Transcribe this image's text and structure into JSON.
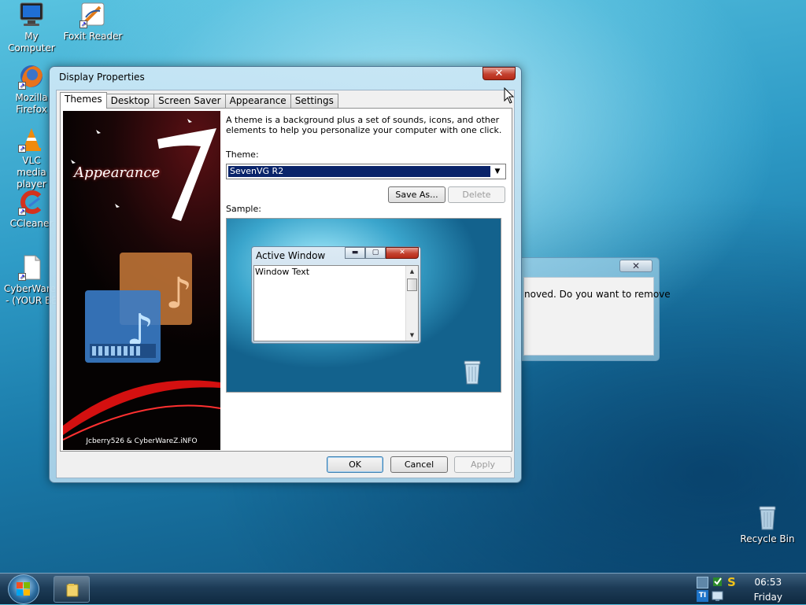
{
  "desktop": {
    "icons": [
      {
        "label": "My Computer",
        "icon": "monitor-icon"
      },
      {
        "label": "Foxit Reader",
        "icon": "foxit-icon"
      },
      {
        "label": "Mozilla Firefox",
        "icon": "firefox-icon"
      },
      {
        "label": "VLC media player",
        "icon": "vlc-cone-icon"
      },
      {
        "label": "CCleaner",
        "icon": "ccleaner-icon"
      },
      {
        "label": "CyberWareZ - (YOUR BE",
        "icon": "document-icon"
      },
      {
        "label": "Recycle Bin",
        "icon": "recycle-bin-icon"
      }
    ]
  },
  "background_dialog": {
    "close_label": "✕",
    "message": "noved.  Do you want to remove"
  },
  "dialog": {
    "title": "Display Properties",
    "close_label": "✕",
    "tabs": [
      "Themes",
      "Desktop",
      "Screen Saver",
      "Appearance",
      "Settings"
    ],
    "active_tab": "Themes",
    "art": {
      "title": "Appearance",
      "numeral": "7",
      "credit": "Jcberry526 & CyberWareZ.iNFO"
    },
    "description": "A theme is a background plus a set of sounds, icons, and other elements to help you personalize your computer with one click.",
    "theme_label": "Theme:",
    "theme_value": "SevenVG R2",
    "save_as_label": "Save As...",
    "delete_label": "Delete",
    "sample_label": "Sample:",
    "sample_window": {
      "title": "Active Window",
      "body_text": "Window Text",
      "minimize": "▬",
      "maximize": "▢",
      "close": "✕"
    },
    "ok_label": "OK",
    "cancel_label": "Cancel",
    "apply_label": "Apply"
  },
  "taskbar": {
    "time": "06:53",
    "day": "Friday"
  },
  "colors": {
    "selection": "#0a246a",
    "close_red": "#c4412f",
    "taskbar": "#1d3c57"
  }
}
